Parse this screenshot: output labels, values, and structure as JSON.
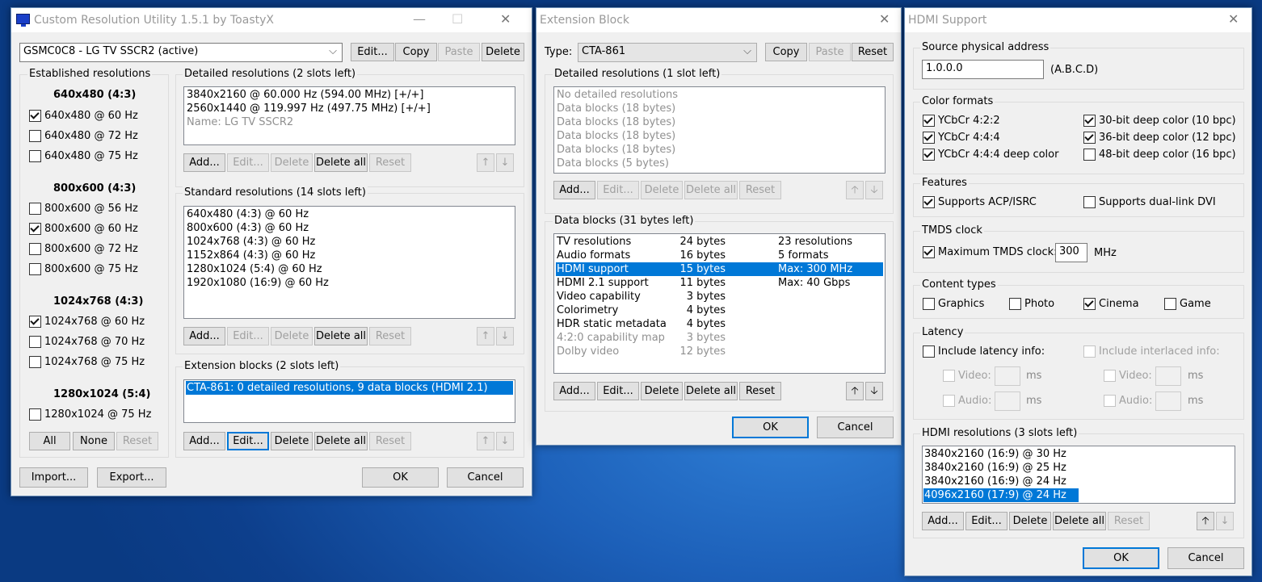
{
  "cru": {
    "title": "Custom Resolution Utility 1.5.1 by ToastyX",
    "display_select": "GSMC0C8 - LG TV SSCR2 (active)",
    "top_buttons": [
      "Edit...",
      "Copy",
      "Paste",
      "Delete"
    ],
    "established": {
      "label": "Established resolutions",
      "groups": [
        {
          "head": "640x480 (4:3)",
          "items": [
            {
              "t": "640x480 @ 60 Hz",
              "on": true
            },
            {
              "t": "640x480 @ 72 Hz",
              "on": false
            },
            {
              "t": "640x480 @ 75 Hz",
              "on": false
            }
          ]
        },
        {
          "head": "800x600 (4:3)",
          "items": [
            {
              "t": "800x600 @ 56 Hz",
              "on": false
            },
            {
              "t": "800x600 @ 60 Hz",
              "on": true
            },
            {
              "t": "800x600 @ 72 Hz",
              "on": false
            },
            {
              "t": "800x600 @ 75 Hz",
              "on": false
            }
          ]
        },
        {
          "head": "1024x768 (4:3)",
          "items": [
            {
              "t": "1024x768 @ 60 Hz",
              "on": true
            },
            {
              "t": "1024x768 @ 70 Hz",
              "on": false
            },
            {
              "t": "1024x768 @ 75 Hz",
              "on": false
            }
          ]
        },
        {
          "head": "1280x1024 (5:4)",
          "items": [
            {
              "t": "1280x1024 @ 75 Hz",
              "on": false
            }
          ]
        }
      ],
      "buttons": [
        "All",
        "None",
        "Reset"
      ]
    },
    "detailed": {
      "label": "Detailed resolutions (2 slots left)",
      "rows": [
        "3840x2160 @ 60.000 Hz (594.00 MHz) [+/+]",
        "2560x1440 @ 119.997 Hz (497.75 MHz) [+/+]",
        "Name: LG TV SSCR2"
      ]
    },
    "standard": {
      "label": "Standard resolutions (14 slots left)",
      "rows": [
        "640x480 (4:3) @ 60 Hz",
        "800x600 (4:3) @ 60 Hz",
        "1024x768 (4:3) @ 60 Hz",
        "1152x864 (4:3) @ 60 Hz",
        "1280x1024 (5:4) @ 60 Hz",
        "1920x1080 (16:9) @ 60 Hz"
      ]
    },
    "extension": {
      "label": "Extension blocks (2 slots left)",
      "rows": [
        "CTA-861: 0 detailed resolutions, 9 data blocks (HDMI 2.1)"
      ]
    },
    "list_buttons": [
      "Add...",
      "Edit...",
      "Delete",
      "Delete all",
      "Reset"
    ],
    "arrows": [
      "↑",
      "↓"
    ],
    "bottom": [
      "Import...",
      "Export...",
      "OK",
      "Cancel"
    ]
  },
  "ext": {
    "title": "Extension Block",
    "type_label": "Type:",
    "type_value": "CTA-861",
    "top_buttons": [
      "Copy",
      "Paste",
      "Reset"
    ],
    "detailed": {
      "label": "Detailed resolutions (1 slot left)",
      "rows": [
        "No detailed resolutions",
        "Data blocks (18 bytes)",
        "Data blocks (18 bytes)",
        "Data blocks (18 bytes)",
        "Data blocks (18 bytes)",
        "Data blocks (5 bytes)"
      ]
    },
    "datablocks": {
      "label": "Data blocks (31 bytes left)",
      "rows": [
        {
          "a": "TV resolutions",
          "b": "24 bytes",
          "c": "23 resolutions"
        },
        {
          "a": "Audio formats",
          "b": "16 bytes",
          "c": "5 formats"
        },
        {
          "a": "HDMI support",
          "b": "15 bytes",
          "c": "Max: 300 MHz"
        },
        {
          "a": "HDMI 2.1 support",
          "b": "11 bytes",
          "c": "Max: 40 Gbps"
        },
        {
          "a": "Video capability",
          "b": "3 bytes",
          "c": ""
        },
        {
          "a": "Colorimetry",
          "b": "4 bytes",
          "c": ""
        },
        {
          "a": "HDR static metadata",
          "b": "4 bytes",
          "c": ""
        },
        {
          "a": "4:2:0 capability map",
          "b": "3 bytes",
          "c": ""
        },
        {
          "a": "Dolby video",
          "b": "12 bytes",
          "c": ""
        }
      ]
    },
    "list_buttons": [
      "Add...",
      "Edit...",
      "Delete",
      "Delete all",
      "Reset"
    ],
    "arrows": [
      "🡡",
      "🡣"
    ],
    "ok": "OK",
    "cancel": "Cancel"
  },
  "hdmi": {
    "title": "HDMI Support",
    "spa_label": "Source physical address",
    "spa_value": "1.0.0.0",
    "spa_hint": "(A.B.C.D)",
    "color_label": "Color formats",
    "colors": [
      {
        "t": "YCbCr 4:2:2",
        "on": true
      },
      {
        "t": "YCbCr 4:4:4",
        "on": true
      },
      {
        "t": "YCbCr 4:4:4 deep color",
        "on": true
      },
      {
        "t": "30-bit deep color (10 bpc)",
        "on": true
      },
      {
        "t": "36-bit deep color (12 bpc)",
        "on": true
      },
      {
        "t": "48-bit deep color (16 bpc)",
        "on": false
      }
    ],
    "features_label": "Features",
    "features": [
      {
        "t": "Supports ACP/ISRC",
        "on": true
      },
      {
        "t": "Supports dual-link DVI",
        "on": false
      }
    ],
    "tmds_label": "TMDS clock",
    "tmds_check": "Maximum TMDS clock:",
    "tmds_value": "300",
    "tmds_unit": "MHz",
    "content_label": "Content types",
    "content": [
      {
        "t": "Graphics",
        "on": false
      },
      {
        "t": "Photo",
        "on": false
      },
      {
        "t": "Cinema",
        "on": true
      },
      {
        "t": "Game",
        "on": false
      }
    ],
    "latency_label": "Latency",
    "lat_include": "Include latency info:",
    "lat_interlaced": "Include interlaced info:",
    "video": "Video:",
    "audio": "Audio:",
    "ms": "ms",
    "res_label": "HDMI resolutions (3 slots left)",
    "res_rows": [
      "3840x2160 (16:9) @ 30 Hz",
      "3840x2160 (16:9) @ 25 Hz",
      "3840x2160 (16:9) @ 24 Hz",
      "4096x2160 (17:9) @ 24 Hz"
    ],
    "list_buttons": [
      "Add...",
      "Edit...",
      "Delete",
      "Delete all",
      "Reset"
    ],
    "arrows": [
      "🡡",
      "↓"
    ],
    "ok": "OK",
    "cancel": "Cancel"
  },
  "colors": {
    "accent": "#0078d7",
    "window_bg": "#f0f0f0",
    "desktop": "#1c5fb8"
  }
}
